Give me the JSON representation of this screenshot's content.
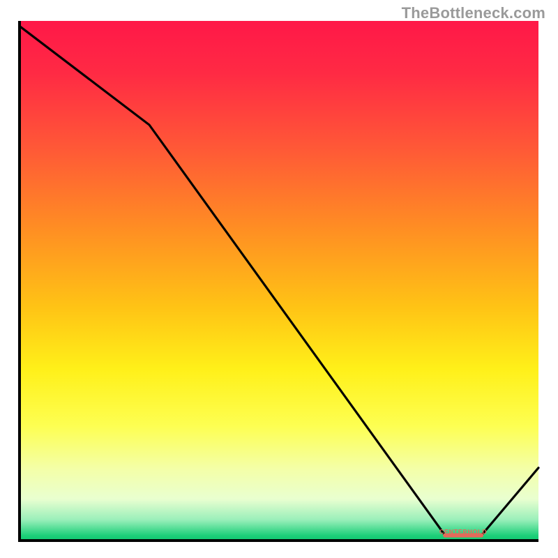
{
  "watermark": "TheBottleneck.com",
  "chart_data": {
    "type": "line",
    "title": "",
    "xlabel": "",
    "ylabel": "",
    "xlim": [
      0,
      100
    ],
    "ylim": [
      0,
      100
    ],
    "grid": false,
    "legend": false,
    "annotations": [
      "CENTERHOLD"
    ],
    "series": [
      {
        "name": "curve",
        "x": [
          0,
          25,
          82,
          89,
          100
        ],
        "values": [
          99,
          80,
          1,
          1,
          14
        ]
      }
    ],
    "gradient_stops": [
      {
        "offset": 0.0,
        "color": "#ff1848"
      },
      {
        "offset": 0.1,
        "color": "#ff2a44"
      },
      {
        "offset": 0.25,
        "color": "#ff5a36"
      },
      {
        "offset": 0.4,
        "color": "#ff8e23"
      },
      {
        "offset": 0.55,
        "color": "#ffc315"
      },
      {
        "offset": 0.67,
        "color": "#fff019"
      },
      {
        "offset": 0.78,
        "color": "#fdff52"
      },
      {
        "offset": 0.86,
        "color": "#f4ffa6"
      },
      {
        "offset": 0.92,
        "color": "#e9ffd0"
      },
      {
        "offset": 0.96,
        "color": "#9aefba"
      },
      {
        "offset": 0.99,
        "color": "#1ed07a"
      },
      {
        "offset": 1.0,
        "color": "#0ec66f"
      }
    ],
    "accent": {
      "label": "CENTERHOLD",
      "color": "#e36a5a",
      "x0": 82,
      "x1": 89,
      "y": 1
    },
    "axis_color": "#000000",
    "curve_color": "#000000"
  }
}
